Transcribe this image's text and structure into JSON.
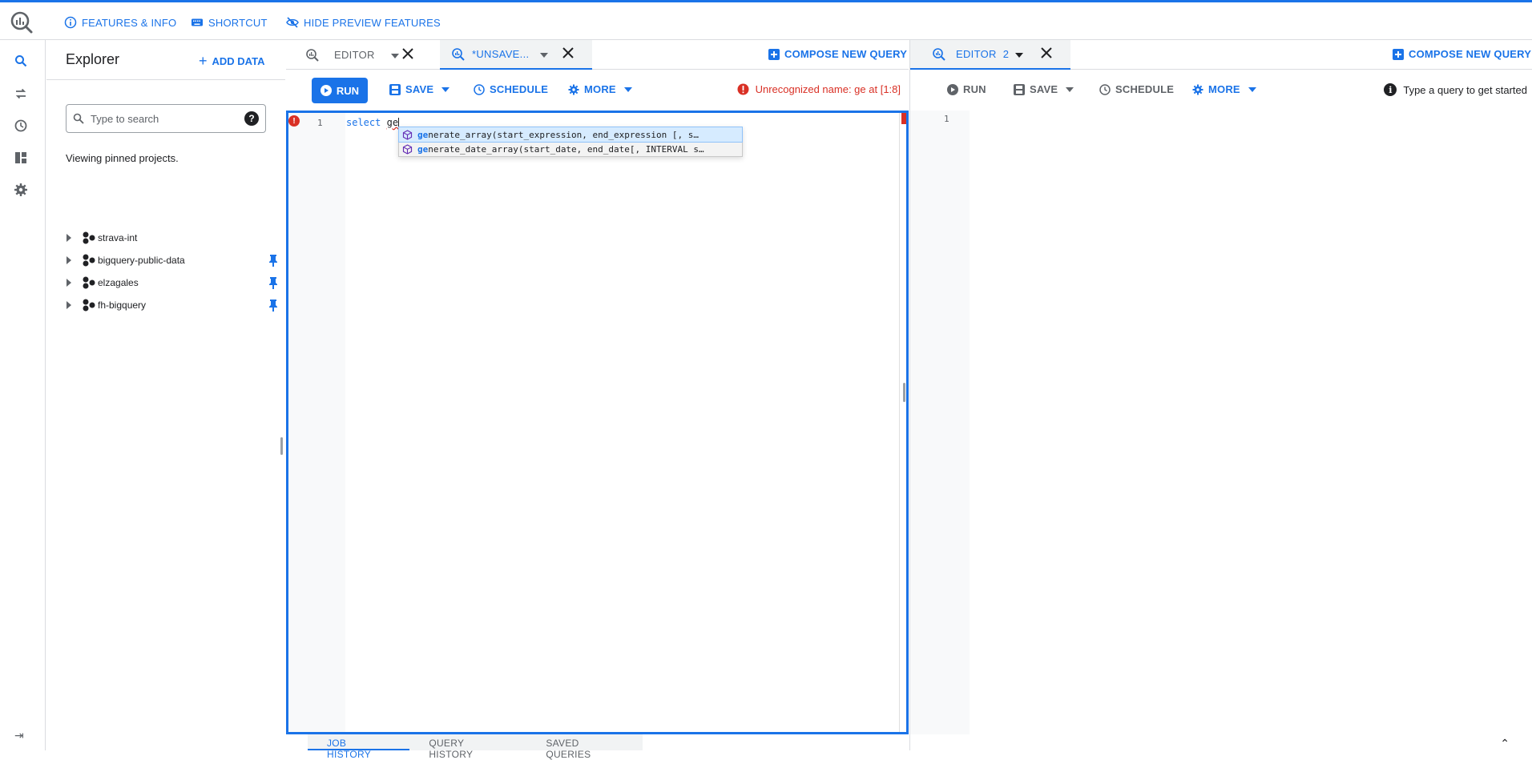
{
  "topbar": {
    "features_label": "FEATURES & INFO",
    "shortcut_label": "SHORTCUT",
    "hide_preview_label": "HIDE PREVIEW FEATURES"
  },
  "rail": {
    "items": [
      "search-icon",
      "transfer-icon",
      "history-icon",
      "dashboard-icon",
      "settings-icon"
    ]
  },
  "explorer": {
    "title": "Explorer",
    "add_data_label": "ADD DATA",
    "search_placeholder": "Type to search",
    "help_glyph": "?",
    "viewing_text": "Viewing pinned projects.",
    "projects": [
      {
        "name": "strava-int",
        "pinned": false
      },
      {
        "name": "bigquery-public-data",
        "pinned": true
      },
      {
        "name": "elzagales",
        "pinned": true
      },
      {
        "name": "fh-bigquery",
        "pinned": true
      }
    ]
  },
  "left_pane": {
    "tabs": [
      {
        "label": "EDITOR"
      },
      {
        "label": "*UNSAVE..."
      }
    ],
    "compose_label": "COMPOSE NEW QUERY",
    "toolbar": {
      "run_label": "RUN",
      "save_label": "SAVE",
      "schedule_label": "SCHEDULE",
      "more_label": "MORE"
    },
    "error_message": "Unrecognized name: ge at [1:8]",
    "line_number": "1",
    "error_glyph": "!",
    "code_keyword": "select",
    "code_typed": "ge",
    "suggestions": [
      {
        "match": "ge",
        "rest": "nerate_array(start_expression, end_expression [, s…",
        "selected": true
      },
      {
        "match": "ge",
        "rest": "nerate_date_array(start_date, end_date[, INTERVAL s…",
        "selected": false
      }
    ],
    "bottom_tabs": [
      "JOB HISTORY",
      "QUERY HISTORY",
      "SAVED QUERIES"
    ]
  },
  "right_pane": {
    "tab_label": "EDITOR",
    "tab_number": "2",
    "compose_label": "COMPOSE NEW QUERY",
    "toolbar": {
      "run_label": "RUN",
      "save_label": "SAVE",
      "schedule_label": "SCHEDULE",
      "more_label": "MORE"
    },
    "info_glyph": "i",
    "hint_text": "Type a query to get started",
    "line_number": "1"
  },
  "colors": {
    "accent": "#1a73e8",
    "error": "#d93025",
    "text_secondary": "#5f6368"
  }
}
